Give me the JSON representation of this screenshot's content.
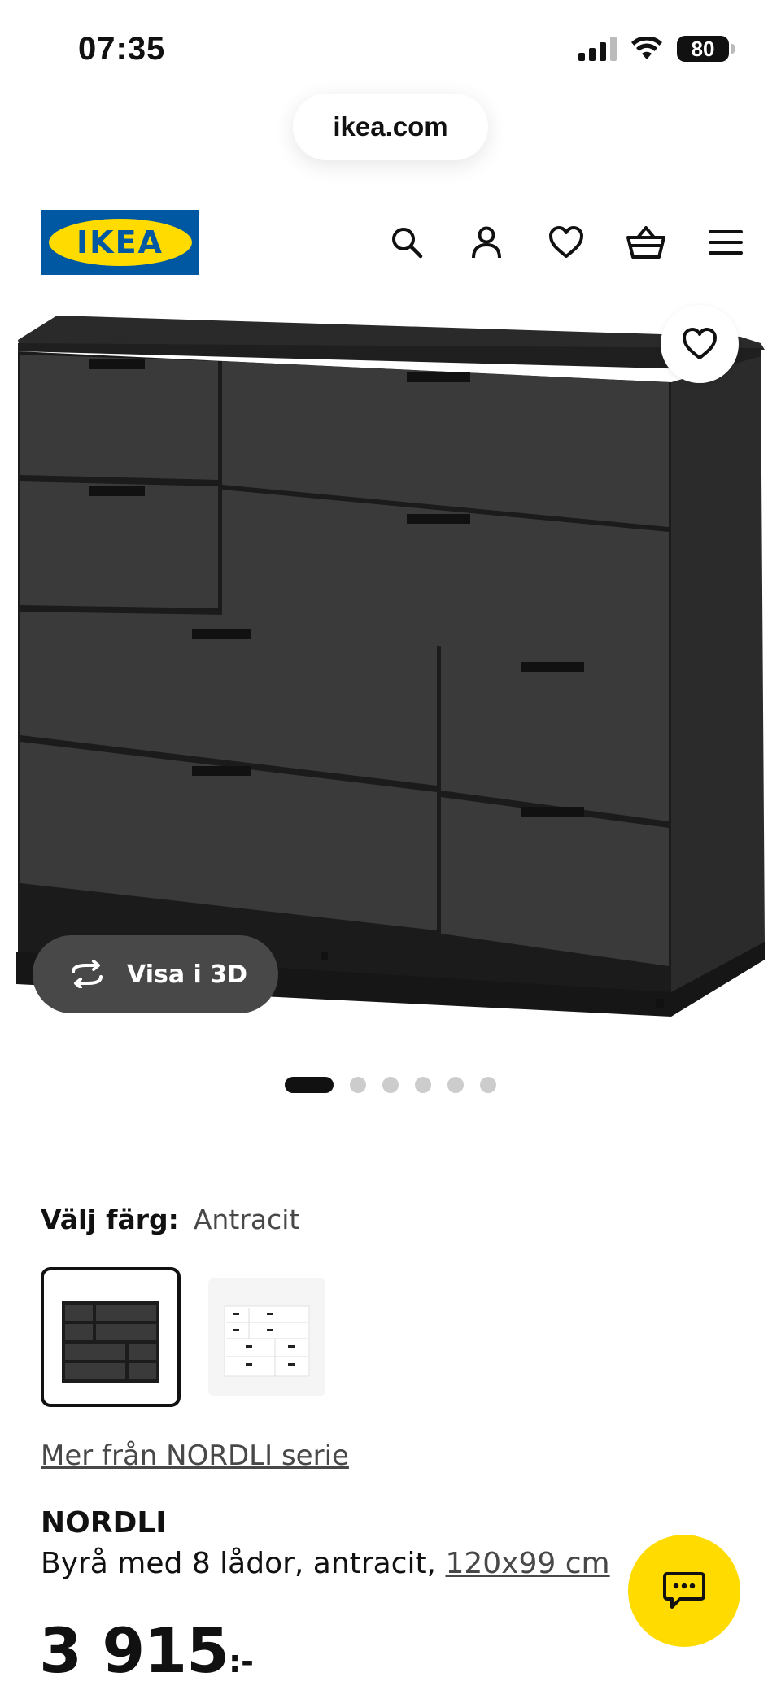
{
  "status_bar": {
    "time": "07:35",
    "battery": "80"
  },
  "browser": {
    "url": "ikea.com"
  },
  "header": {
    "logo_text": "IKEA",
    "icons": [
      "search-icon",
      "user-icon",
      "heart-icon",
      "cart-icon",
      "menu-icon"
    ]
  },
  "gallery": {
    "view_3d_label": "Visa i 3D",
    "active_image": 1,
    "image_count": 6
  },
  "color": {
    "label": "Välj färg:",
    "value": "Antracit",
    "options": [
      "Antracit",
      "Vit"
    ]
  },
  "series_link": "Mer från NORDLI serie",
  "product": {
    "name": "NORDLI",
    "description": "Byrå med 8 lådor, antracit,",
    "dimensions": "120x99 cm",
    "price": "3 915",
    "price_suffix": ":-"
  },
  "colors": {
    "brand_blue": "#0058a3",
    "brand_yellow": "#ffdb00",
    "dark": "#111111"
  }
}
